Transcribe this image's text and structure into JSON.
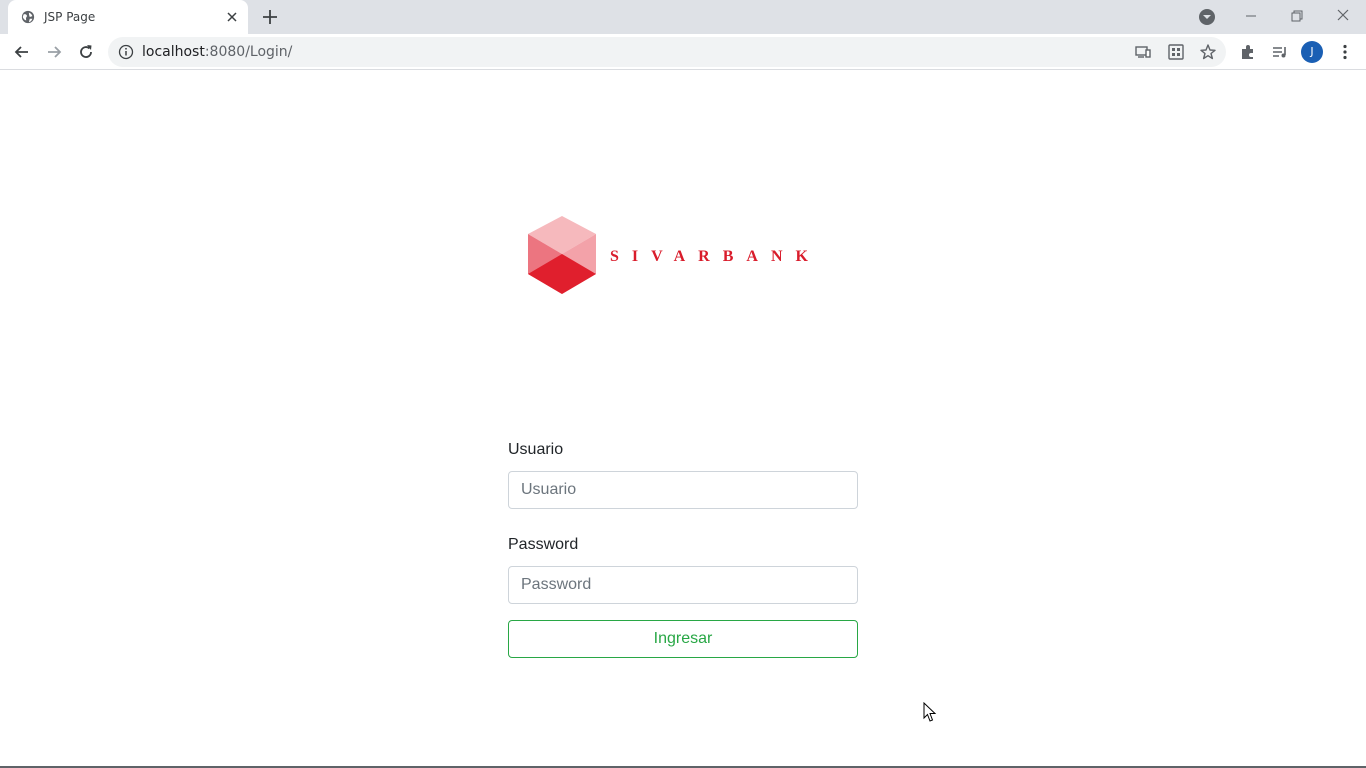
{
  "browser": {
    "tab_title": "JSP Page",
    "url_host": "localhost",
    "url_rest": ":8080/Login/",
    "profile_initial": "J"
  },
  "logo": {
    "text": "SIVARBANK",
    "colors": {
      "light": "#f6b9bd",
      "mid": "#ec7580",
      "dark": "#e01f2d",
      "text": "#d91c2b"
    }
  },
  "form": {
    "username_label": "Usuario",
    "username_placeholder": "Usuario",
    "password_label": "Password",
    "password_placeholder": "Password",
    "submit_label": "Ingresar"
  },
  "colors": {
    "accent": "#28a745",
    "tabstrip": "#dee1e6"
  }
}
